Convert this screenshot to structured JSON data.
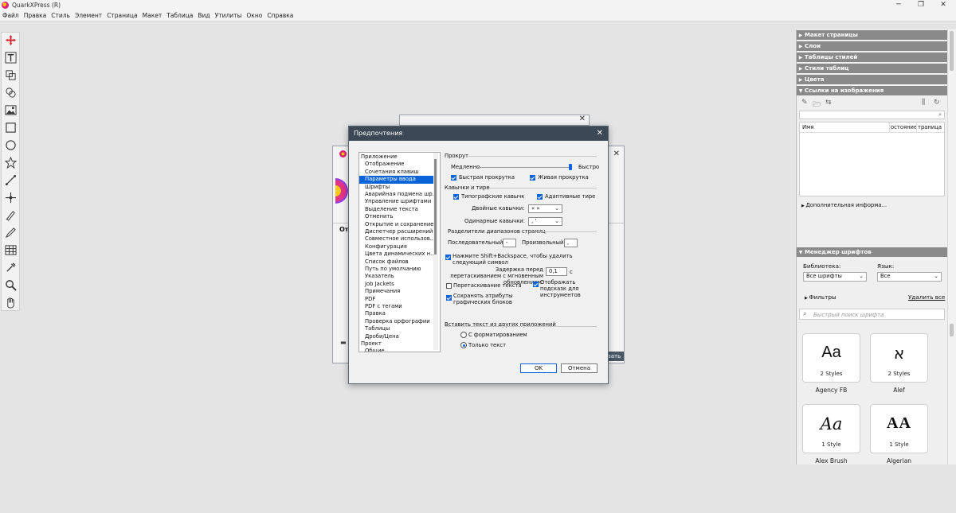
{
  "app": {
    "title": "QuarkXPress (R)",
    "window_controls": [
      "─",
      "❐",
      "✕"
    ]
  },
  "menubar": [
    "Файл",
    "Правка",
    "Стиль",
    "Элемент",
    "Страница",
    "Макет",
    "Таблица",
    "Вид",
    "Утилиты",
    "Окно",
    "Справка"
  ],
  "toolbox": [
    "move-tool",
    "text-tool",
    "text-linking-tool",
    "text-unlinking-tool",
    "picture-content-tool",
    "rectangle-box-tool",
    "oval-box-tool",
    "star-box-tool",
    "line-tool",
    "bezier-pen-tool",
    "bezier-select-tool",
    "pencil-tool",
    "table-tool",
    "eyedropper-tool",
    "zoom-tool",
    "pan-tool"
  ],
  "background_windows": {
    "left_fragment": "От",
    "right_fragment": "зать"
  },
  "dialog": {
    "title": "Предпочтения",
    "nav": [
      "Приложение",
      "Отображение",
      "Сочетания клавиш",
      "Параметры ввода",
      "Шрифты",
      "Аварийная подмена шр...",
      "Управление шрифтами",
      "Выделение текста",
      "Отменить",
      "Открытие и сохранение",
      "Диспетчер расширений",
      "Совместное использов...",
      "Конфигурация",
      "Цвета динамических н...",
      "Список файлов",
      "Путь по умолчанию",
      "Указатель",
      "Job Jackets",
      "Примечания",
      "PDF",
      "PDF с тегами",
      "Правка",
      "Проверка орфографии",
      "Таблицы",
      "Дроби/Цена",
      "Проект",
      "Общие"
    ],
    "nav_selected": "Параметры ввода",
    "scroll": {
      "section": "Прокрут",
      "slow": "Медленно",
      "fast": "Быстро",
      "speed_fraction": 0.98,
      "fast_scroll": {
        "label": "Быстрая прокрутка",
        "checked": true
      },
      "live_scroll": {
        "label": "Живая прокрутка",
        "checked": true
      }
    },
    "quotes": {
      "section": "Кавычки и тире",
      "typographic": {
        "label": "Типографские кавычк",
        "checked": true
      },
      "adaptive_dashes": {
        "label": "Адаптивные тире",
        "checked": true
      },
      "double_label": "Двойные кавычки:",
      "double_value": "« »",
      "single_label": "Одинарные кавычки:",
      "single_value": "‚ ‘"
    },
    "ranges": {
      "section": "Разделители диапазонов страниц",
      "sequential_label": "Последовательный:",
      "sequential_value": "-",
      "arbitrary_label": "Произвольный:",
      "arbitrary_value": ","
    },
    "shift_backspace": {
      "label": "Нажмите Shift+Backspace, чтобы удалить следующий символ",
      "checked": true
    },
    "delay": {
      "label": "Задержка перед перетаскиванием с мгновенным обновлением:",
      "value": "0,1",
      "unit": "с"
    },
    "drag_text": {
      "label": "Перетаскивание текста",
      "checked": false
    },
    "tooltips": {
      "label": "Отображать подсказк для инструментов",
      "checked": true
    },
    "keep_box_attrs": {
      "label": "Сохранять атрибуты графических блоков",
      "checked": true
    },
    "paste": {
      "section": "Вставить текст из других приложений",
      "with_format": "С форматированием",
      "text_only": "Только текст",
      "selected": "text_only"
    },
    "ok": "OK",
    "cancel": "Отмена"
  },
  "right_panels": {
    "collapsed": [
      "Макет страницы",
      "Слои",
      "Таблицы стилей",
      "Стили таблиц",
      "Цвета"
    ],
    "image_links": {
      "title": "Ссылки на изображения",
      "columns": [
        "Имя",
        "остояние",
        "траница"
      ],
      "more_info": "Дополнительная информа..."
    },
    "font_manager": {
      "title": "Менеджер шрифтов",
      "library_label": "Библиотека:",
      "library_value": "Все шрифты",
      "language_label": "Язык:",
      "language_value": "Все",
      "filters": "Фильтры",
      "delete_all": "Удалить все",
      "search_placeholder": "Быстрый поиск шрифта",
      "fonts": [
        {
          "name": "Agency FB",
          "styles": "2 Styles",
          "sample": "Aa"
        },
        {
          "name": "Alef",
          "styles": "2 Styles",
          "sample": "א"
        },
        {
          "name": "Alex Brush",
          "styles": "1 Style",
          "sample": "Aa"
        },
        {
          "name": "Algerian",
          "styles": "1 Style",
          "sample": "AA"
        }
      ]
    }
  }
}
